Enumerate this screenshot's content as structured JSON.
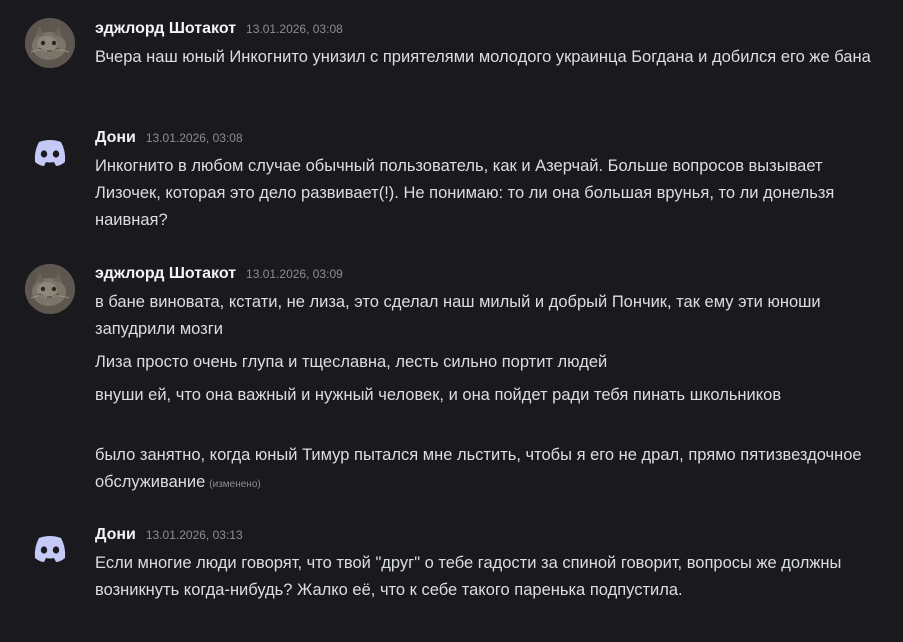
{
  "messages": [
    {
      "author": "эджлорд Шотакот",
      "avatar": "cat-photo-avatar",
      "time": "13.01.2026, 03:08",
      "lines": [
        "Вчера наш юный Инкогнито унизил с приятелями молодого украинца Богдана и добился его же бана"
      ]
    },
    {
      "author": "Дони",
      "avatar": "discord-logo-avatar",
      "time": "13.01.2026, 03:08",
      "lines": [
        "Инкогнито в любом случае обычный пользователь, как и Азерчай. Больше вопросов вызывает Лизочек, которая это дело развивает(!). Не понимаю: то ли она большая врунья, то ли донельзя наивная?"
      ]
    },
    {
      "author": "эджлорд Шотакот",
      "avatar": "cat-photo-avatar",
      "time": "13.01.2026, 03:09",
      "lines": [
        "в бане виновата, кстати, не лиза, это сделал наш милый и добрый Пончик, так ему эти юноши запудрили мозги",
        "Лиза просто очень глупа и тщеславна, лесть сильно портит людей",
        "внуши ей, что она важный и нужный человек, и она пойдет ради тебя пинать школьников",
        "было занятно, когда юный Тимур пытался мне льстить, чтобы я его не драл, прямо пятизвездочное обслуживание"
      ],
      "edited_label": "(изменено)"
    },
    {
      "author": "Дони",
      "avatar": "discord-logo-avatar",
      "time": "13.01.2026, 03:13",
      "lines": [
        "Если многие люди говорят, что твой \"друг\" о тебе гадости за спиной говорит, вопросы же должны возникнуть когда-нибудь? Жалко её, что к себе такого паренька подпустила."
      ]
    }
  ],
  "colors": {
    "background": "#1a1a1e",
    "text": "#dbdee1",
    "username": "#f2f3f5",
    "timestamp": "#8a8d94",
    "discord_blurple": "#c5c9f7"
  }
}
